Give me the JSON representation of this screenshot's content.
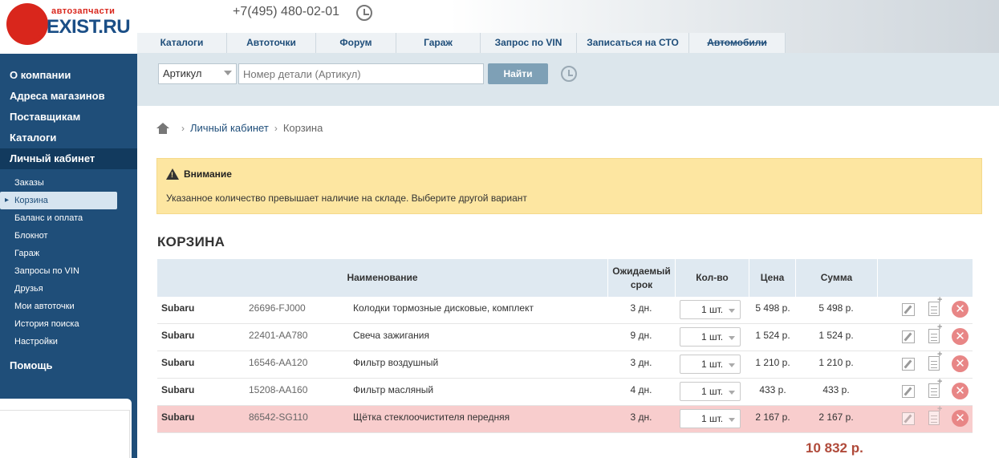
{
  "header": {
    "logo_sub": "автозапчасти",
    "logo_text": "EXIST.RU",
    "phone": "+7(495) 480-02-01"
  },
  "topnav": [
    {
      "label": "Каталоги",
      "w": 0
    },
    {
      "label": "Автоточки"
    },
    {
      "label": "Форум"
    },
    {
      "label": "Гараж"
    },
    {
      "label": "Запрос по VIN"
    },
    {
      "label": "Записаться на СТО"
    },
    {
      "label": "Автомобили"
    }
  ],
  "sidebar": {
    "main": [
      "О компании",
      "Адреса магазинов",
      "Поставщикам",
      "Каталоги",
      "Личный кабинет"
    ],
    "sub": [
      "Заказы",
      "Корзина",
      "Баланс и оплата",
      "Блокнот",
      "Гараж",
      "Запросы по VIN",
      "Друзья",
      "Мои автоточки",
      "История поиска",
      "Настройки"
    ],
    "help": "Помощь"
  },
  "search": {
    "select_value": "Артикул",
    "placeholder": "Номер детали (Артикул)",
    "button": "Найти"
  },
  "breadcrumb": {
    "link": "Личный кабинет",
    "current": "Корзина"
  },
  "alert": {
    "title": "Внимание",
    "text": "Указанное количество превышает наличие на складе. Выберите другой вариант"
  },
  "cart": {
    "title": "КОРЗИНА",
    "headers": {
      "name": "Наименование",
      "term": "Ожидаемый срок",
      "qty": "Кол-во",
      "price": "Цена",
      "sum": "Сумма"
    },
    "rows": [
      {
        "brand": "Subaru",
        "article": "26696-FJ000",
        "name": "Колодки тормозные дисковые, комплект",
        "term": "3 дн.",
        "qty": "1 шт.",
        "price": "5 498 р.",
        "sum": "5 498 р."
      },
      {
        "brand": "Subaru",
        "article": "22401-AA780",
        "name": "Свеча зажигания",
        "term": "9 дн.",
        "qty": "1 шт.",
        "price": "1 524 р.",
        "sum": "1 524 р."
      },
      {
        "brand": "Subaru",
        "article": "16546-AA120",
        "name": "Фильтр воздушный",
        "term": "3 дн.",
        "qty": "1 шт.",
        "price": "1 210 р.",
        "sum": "1 210 р."
      },
      {
        "brand": "Subaru",
        "article": "15208-AA160",
        "name": "Фильтр масляный",
        "term": "4 дн.",
        "qty": "1 шт.",
        "price": "433 р.",
        "sum": "433 р."
      },
      {
        "brand": "Subaru",
        "article": "86542-SG110",
        "name": "Щётка стеклоочистителя передняя",
        "term": "3 дн.",
        "qty": "1 шт.",
        "price": "2 167 р.",
        "sum": "2 167 р."
      }
    ],
    "total": "10 832 р."
  },
  "colors": {
    "sidebar": "#1f4e79",
    "alert_bg": "#fde6a1",
    "error_row": "#f8cdcd",
    "total": "#b04a3a"
  }
}
